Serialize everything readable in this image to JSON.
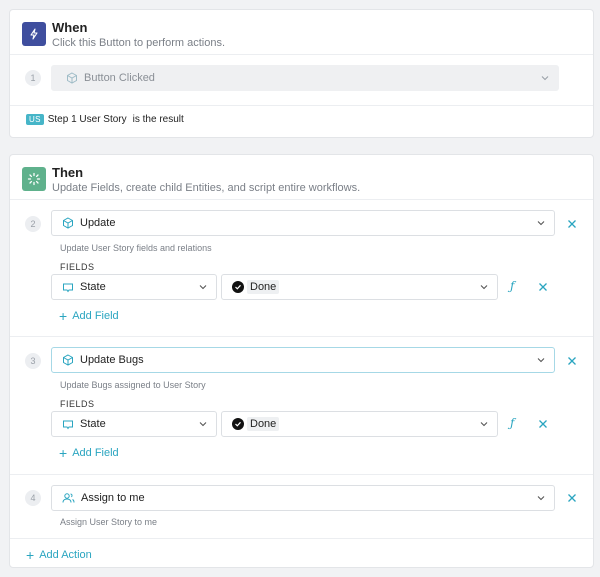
{
  "when": {
    "title": "When",
    "subtitle": "Click this Button to perform actions.",
    "step_number": "1",
    "trigger_label": "Button Clicked",
    "result": {
      "badge": "US",
      "entity": "Step 1 User Story",
      "suffix": "is the result"
    }
  },
  "then": {
    "title": "Then",
    "subtitle": "Update Fields, create child Entities, and script entire workflows.",
    "fields_heading": "FIELDS",
    "add_field_label": "Add Field",
    "add_action_label": "Add Action",
    "steps": [
      {
        "number": "2",
        "label": "Update",
        "description": "Update User Story fields and relations",
        "field": {
          "name": "State",
          "value": "Done"
        }
      },
      {
        "number": "3",
        "label": "Update Bugs",
        "description": "Update Bugs assigned to User Story",
        "field": {
          "name": "State",
          "value": "Done"
        }
      },
      {
        "number": "4",
        "label": "Assign to me",
        "description": "Assign User Story to me"
      }
    ]
  },
  "colors": {
    "accent": "#2aa5c0",
    "when_badge": "#3f4e9e",
    "then_badge": "#5fb18c"
  }
}
